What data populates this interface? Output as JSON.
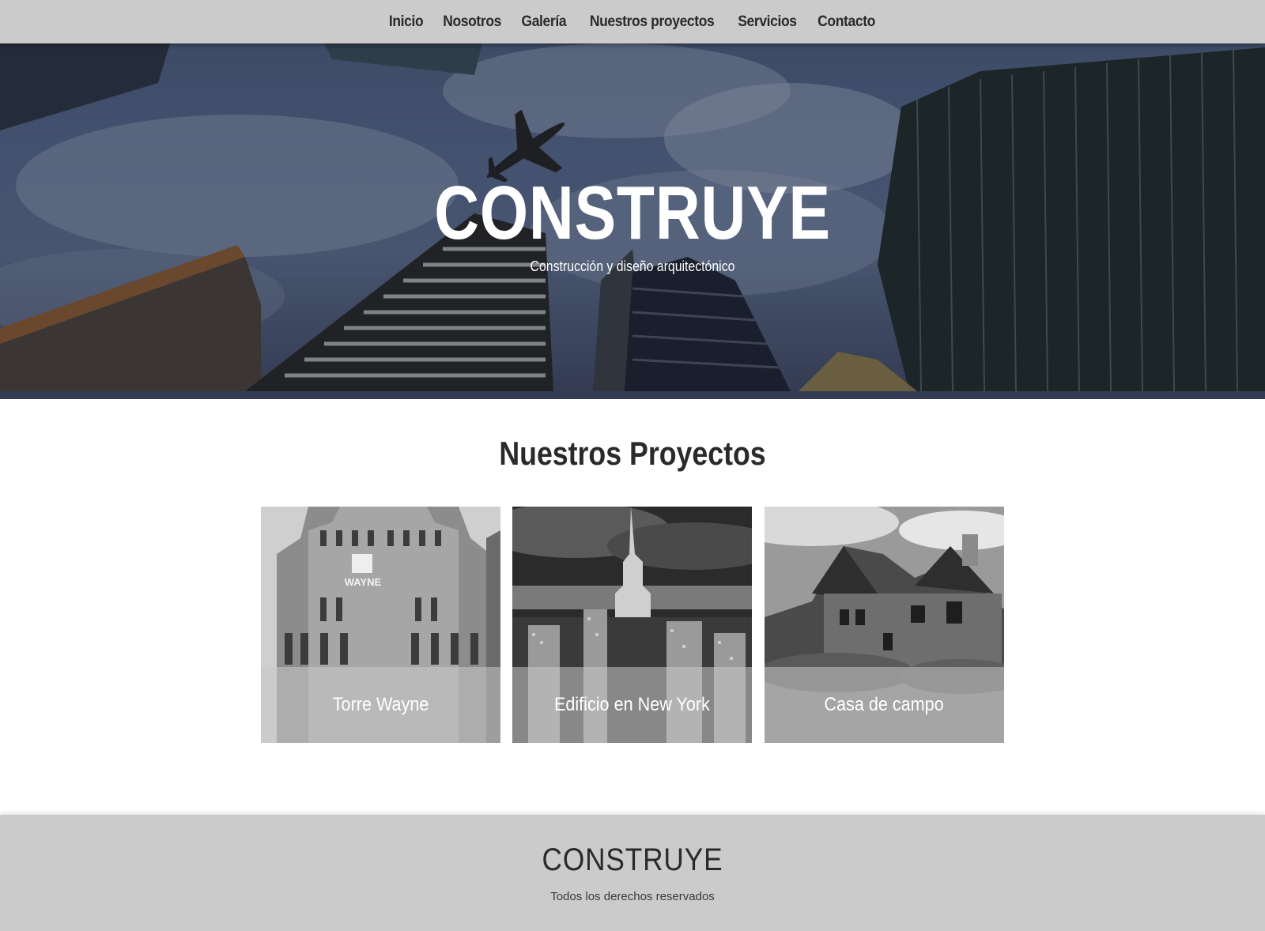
{
  "nav": {
    "items": [
      {
        "label": "Inicio"
      },
      {
        "label": "Nosotros"
      },
      {
        "label": "Galería"
      },
      {
        "label": "Nuestros proyectos"
      },
      {
        "label": "Servicios"
      },
      {
        "label": "Contacto"
      }
    ]
  },
  "hero": {
    "title": "CONSTRUYE",
    "subtitle": "Construcción y diseño arquitectónico"
  },
  "projects": {
    "title": "Nuestros Proyectos",
    "cards": [
      {
        "caption": "Torre Wayne",
        "sign": "WAYNE"
      },
      {
        "caption": "Edificio en New York"
      },
      {
        "caption": "Casa de campo"
      }
    ]
  },
  "footer": {
    "brand": "CONSTRUYE",
    "rights": "Todos los derechos reservados"
  }
}
